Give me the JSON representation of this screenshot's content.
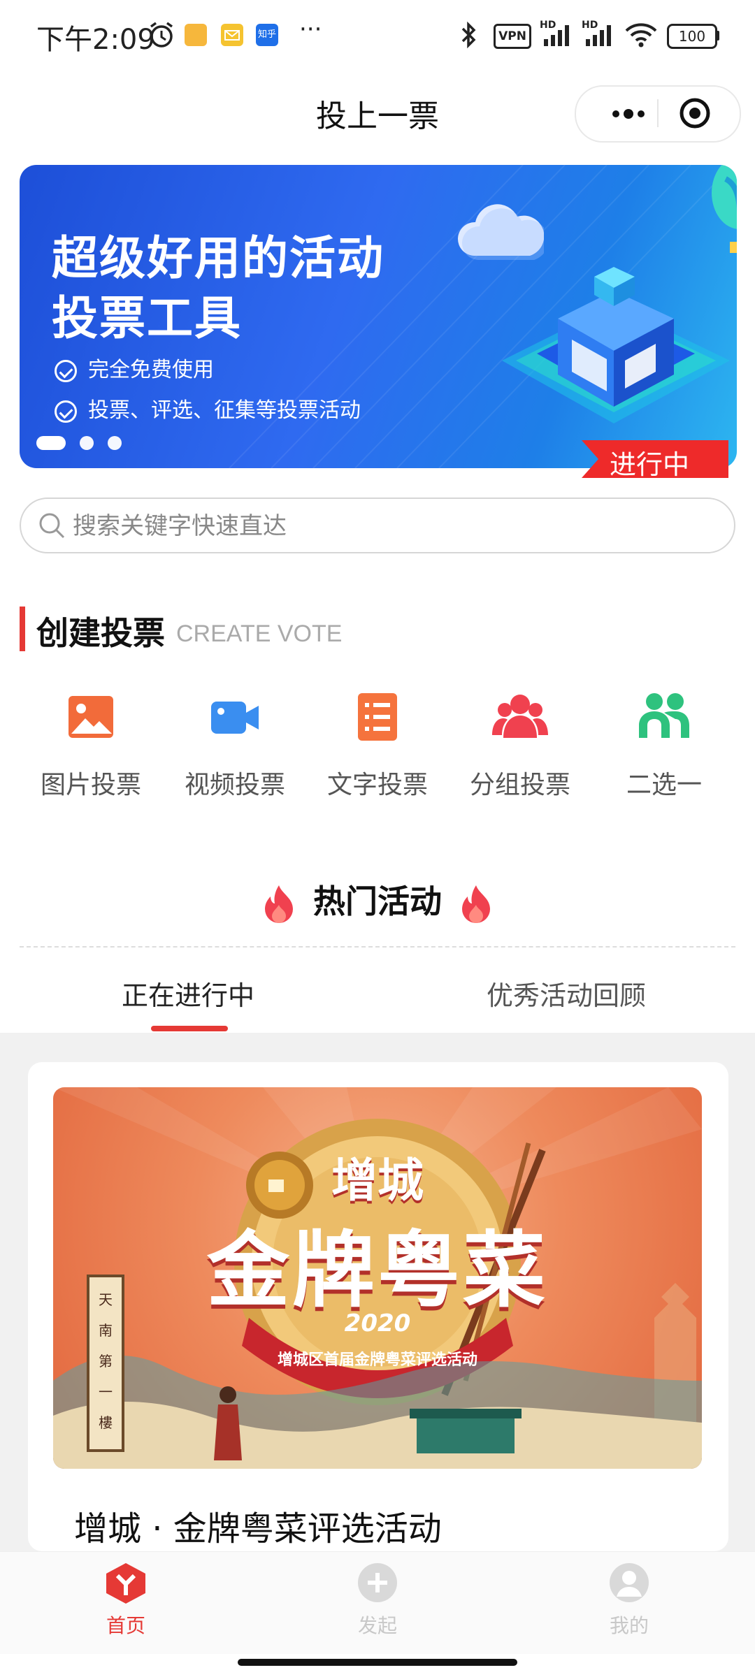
{
  "status_bar": {
    "time": "下午2:09",
    "app_badge": "知乎",
    "more": "···",
    "vpn": "VPN",
    "hd1": "HD",
    "hd2": "HD",
    "battery": "100"
  },
  "nav": {
    "title": "投上一票"
  },
  "banner": {
    "headline_1": "超级好用的活动",
    "headline_2": "投票工具",
    "feature_1": "完全免费使用",
    "feature_2": "投票、评选、征集等投票活动",
    "active_slide": 1,
    "slide_count": 3
  },
  "search": {
    "placeholder": "搜索关键字快速直达"
  },
  "create": {
    "title": "创建投票",
    "subtitle": "CREATE VOTE",
    "items": [
      {
        "label": "图片投票",
        "icon": "image-icon",
        "color": "#f26b3a"
      },
      {
        "label": "视频投票",
        "icon": "video-camera-icon",
        "color": "#3a8ef0"
      },
      {
        "label": "文字投票",
        "icon": "text-list-icon",
        "color": "#f5733d"
      },
      {
        "label": "分组投票",
        "icon": "group-icon",
        "color": "#f0414f"
      },
      {
        "label": "二选一",
        "icon": "two-people-icon",
        "color": "#2ec27e"
      }
    ]
  },
  "hot": {
    "title": "热门活动",
    "tabs": [
      {
        "label": "正在进行中",
        "active": true
      },
      {
        "label": "优秀活动回顾",
        "active": false
      }
    ]
  },
  "activity_card": {
    "poster_line_1": "增城",
    "poster_line_2": "金牌粤菜",
    "poster_year": "2020",
    "poster_ribbon": "增城区首届金牌粤菜评选活动",
    "poster_side_text": "天南第一樓",
    "title": "增城 · 金牌粤菜评选活动",
    "status": "进行中"
  },
  "bottom_nav": [
    {
      "label": "首页",
      "icon": "home-logo-icon",
      "active": true
    },
    {
      "label": "发起",
      "icon": "add-circle-icon",
      "active": false
    },
    {
      "label": "我的",
      "icon": "profile-icon",
      "active": false
    }
  ],
  "colors": {
    "accent": "#e53935",
    "banner_blue": "#2f6af0",
    "poster_orange": "#e2663d"
  }
}
